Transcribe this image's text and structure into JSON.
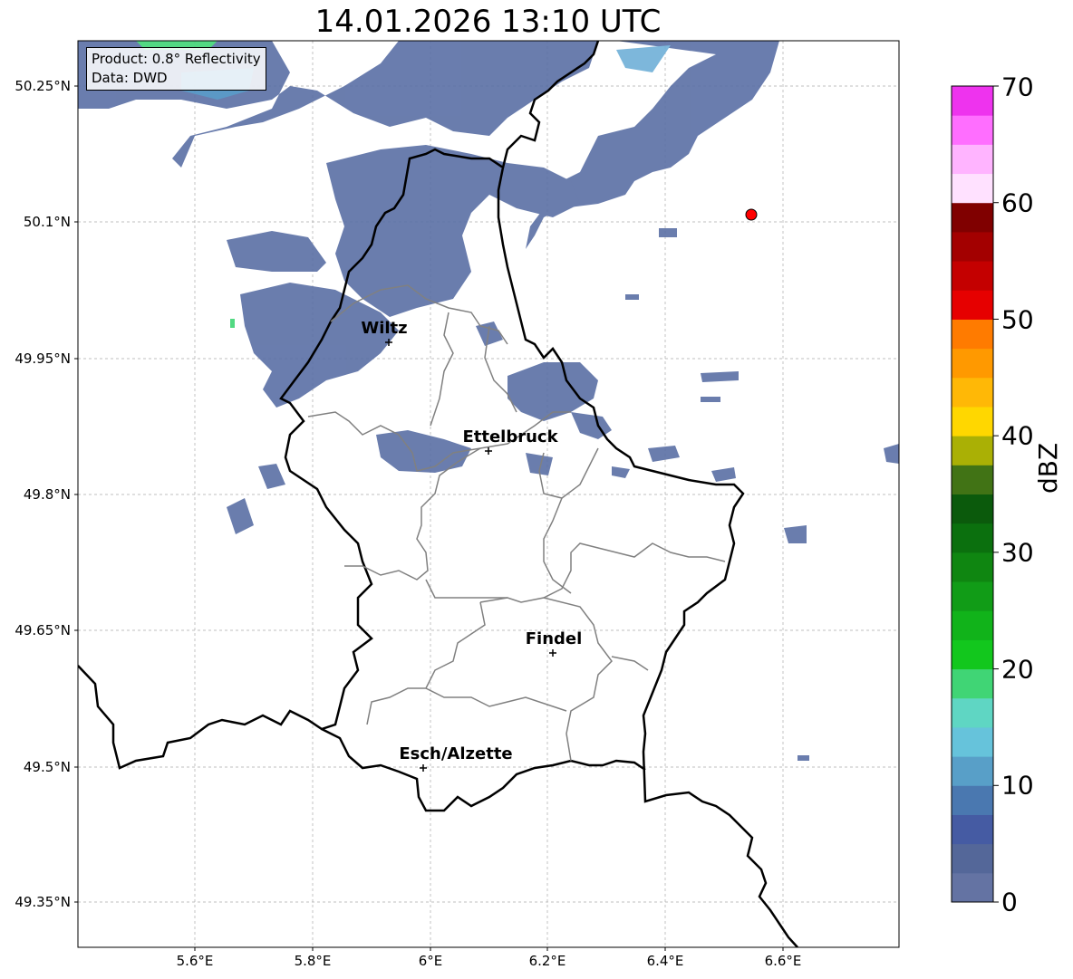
{
  "title": "14.01.2026 13:10 UTC",
  "info": {
    "product": "Product: 0.8° Reflectivity",
    "source": "Data: DWD"
  },
  "lat_labels": [
    "50.25°N",
    "50.1°N",
    "49.95°N",
    "49.8°N",
    "49.65°N",
    "49.5°N",
    "49.35°N"
  ],
  "lon_labels": [
    "5.6°E",
    "5.8°E",
    "6°E",
    "6.2°E",
    "6.4°E",
    "6.6°E"
  ],
  "cities": [
    {
      "name": "Wiltz"
    },
    {
      "name": "Ettelbruck"
    },
    {
      "name": "Findel"
    },
    {
      "name": "Esch/Alzette"
    }
  ],
  "colorbar": {
    "label": "dBZ",
    "ticks": [
      "0",
      "10",
      "20",
      "30",
      "40",
      "50",
      "60",
      "70"
    ],
    "min": 0,
    "max": 70,
    "colors": [
      "#6473a3",
      "#546799",
      "#455ba3",
      "#4a78b0",
      "#589fc8",
      "#66c3db",
      "#5fd6c3",
      "#40d575",
      "#12c71d",
      "#11b31a",
      "#119c17",
      "#0f8611",
      "#0b700e",
      "#0b5a0c",
      "#417315",
      "#aab005",
      "#ffd700",
      "#ffb806",
      "#ff9900",
      "#ff7b00",
      "#e60000",
      "#c40000",
      "#a30000",
      "#800000",
      "#ffe1ff",
      "#ffb4ff",
      "#ff6eff",
      "#ee33ee"
    ]
  },
  "marker_color": "#ff0000"
}
